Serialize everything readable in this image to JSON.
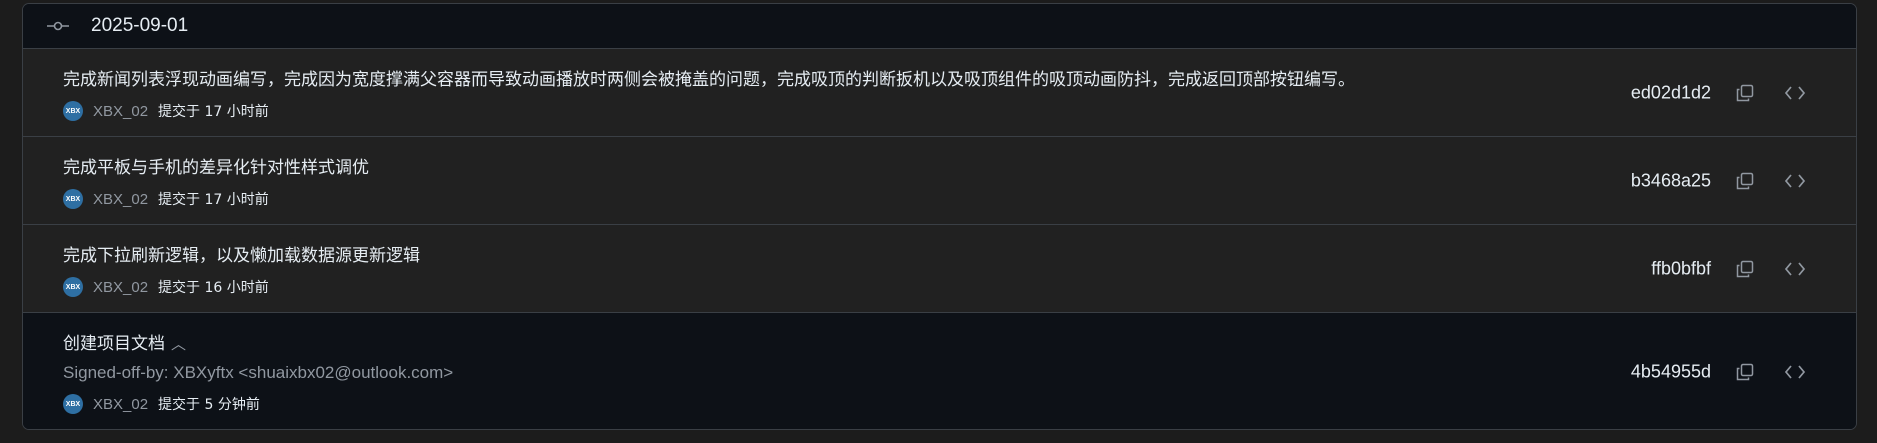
{
  "group": {
    "date": "2025-09-01"
  },
  "commits": [
    {
      "message": "完成新闻列表浮现动画编写，完成因为宽度撑满父容器而导致动画播放时两侧会被掩盖的问题，完成吸顶的判断扳机以及吸顶组件的吸顶动画防抖，完成返回顶部按钮编写。",
      "author": "XBX_02",
      "time": "提交于 17 小时前",
      "sha": "ed02d1d2",
      "avatar_text": "XBX"
    },
    {
      "message": "完成平板与手机的差异化针对性样式调优",
      "author": "XBX_02",
      "time": "提交于 17 小时前",
      "sha": "b3468a25",
      "avatar_text": "XBX"
    },
    {
      "message": "完成下拉刷新逻辑，以及懒加载数据源更新逻辑",
      "author": "XBX_02",
      "time": "提交于 16 小时前",
      "sha": "ffb0bfbf",
      "avatar_text": "XBX"
    },
    {
      "message": "创建项目文档",
      "body": "Signed-off-by: XBXyftx <shuaixbx02@outlook.com>",
      "author": "XBX_02",
      "time": "提交于 5 分钟前",
      "sha": "4b54955d",
      "avatar_text": "XBX"
    }
  ],
  "icons": {
    "header": "git-commit-icon",
    "copy": "copy-icon",
    "browse": "code-icon",
    "collapse": "chevron-up-icon"
  }
}
